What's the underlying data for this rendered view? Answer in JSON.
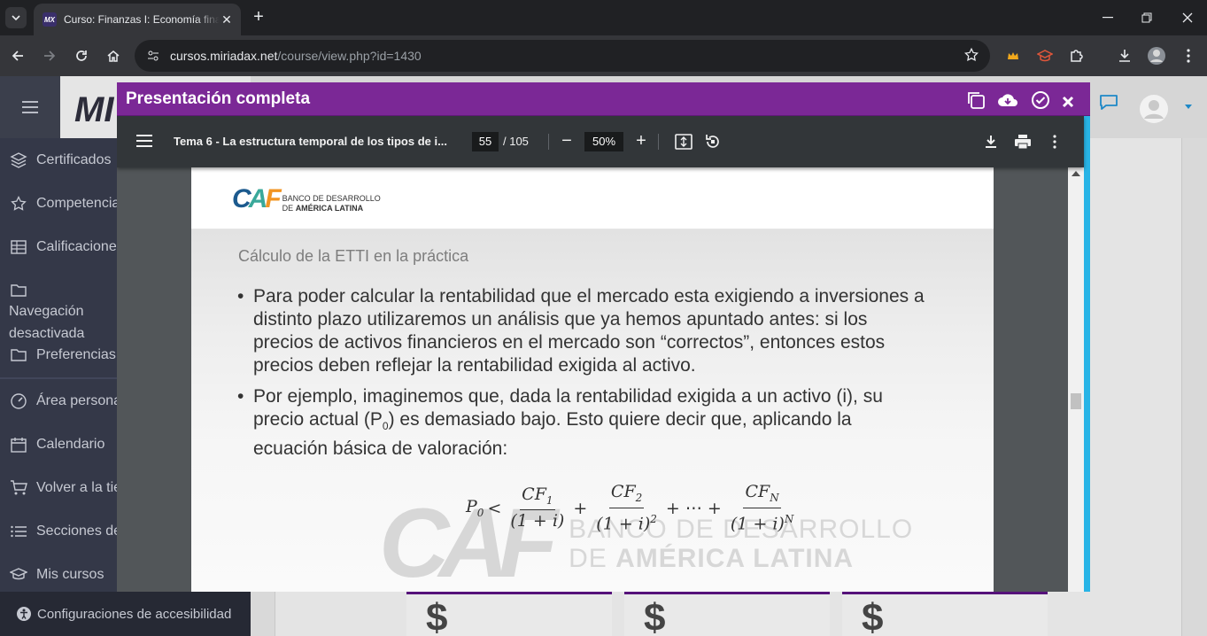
{
  "browser": {
    "tab_title": "Curso: Finanzas I: Economía financiera",
    "tab_favicon": "MX",
    "url_host": "cursos.miriadax.net",
    "url_path": "/course/view.php?id=1430"
  },
  "site": {
    "logo_text": "MI",
    "sidebar": [
      {
        "label": "Certificados",
        "icon": "layers-icon"
      },
      {
        "label": "Competencias",
        "icon": "star-icon"
      },
      {
        "label": "Calificaciones",
        "icon": "table-icon"
      },
      {
        "label": "Navegación desactivada",
        "icon": "folder-icon"
      },
      {
        "label": "Preferencias",
        "icon": "folder-icon"
      },
      {
        "label": "Área personal",
        "icon": "dashboard-icon"
      },
      {
        "label": "Calendario",
        "icon": "calendar-icon"
      },
      {
        "label": "Volver a la tienda",
        "icon": "cart-icon"
      },
      {
        "label": "Secciones del curso",
        "icon": "list-icon"
      },
      {
        "label": "Mis cursos",
        "icon": "graduation-cap-icon"
      }
    ],
    "accessibility_label": "Configuraciones de accesibilidad",
    "card_symbol": "$"
  },
  "modal": {
    "title": "Presentación completa"
  },
  "pdf": {
    "doc_title": "Tema 6 - La estructura temporal de los tipos de i...",
    "page_current": "55",
    "page_total": "/ 105",
    "zoom": "50%"
  },
  "slide": {
    "logo_line1": "BANCO DE DESARROLLO",
    "logo_line2_prefix": "DE ",
    "logo_line2_bold": "AMÉRICA LATINA",
    "heading": "Cálculo de la ETTI en la práctica",
    "bullet1": "Para poder calcular la rentabilidad que el mercado esta exigiendo a inversiones a distinto plazo utilizaremos un análisis que ya hemos apuntado antes: si los precios de activos financieros en el mercado son “correctos”, entonces estos precios deben reflejar la rentabilidad exigida al activo.",
    "bullet2_a": "Por ejemplo, imaginemos que, dada la rentabilidad exigida a un activo (i), su precio actual (P",
    "bullet2_sub": "0",
    "bullet2_b": ") es demasiado bajo. Esto quiere decir que, aplicando la ecuación básica de valoración:",
    "watermark_line1": "BANCO DE DESARROLLO",
    "watermark_line2_prefix": "DE ",
    "watermark_line2_bold": "AMÉRICA LATINA"
  },
  "colors": {
    "modal_header": "#7b2896",
    "caf_blue": "#1c5a8e",
    "caf_green": "#3aa89a",
    "caf_orange": "#f29422",
    "accent_strip": "#28b4e6"
  }
}
